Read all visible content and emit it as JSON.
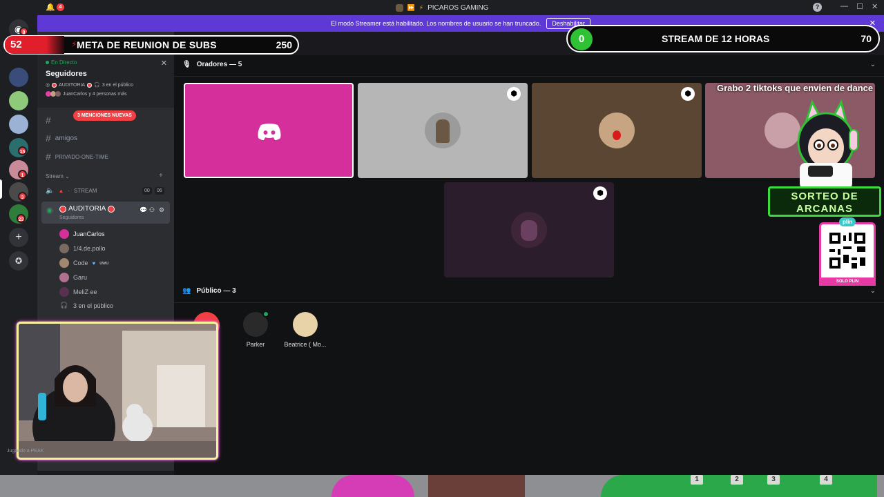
{
  "titlebar": {
    "server_name": "PICAROS GAMING",
    "notification_count": "4",
    "help": "?",
    "minimize": "—",
    "maximize": "☐",
    "close": "✕"
  },
  "banner": {
    "message": "El modo Streamer está habilitado. Los nombres de usuario se han truncado.",
    "disable_label": "Deshabilitar"
  },
  "rail": {
    "badges": [
      "8",
      "15",
      "1",
      "3",
      "23"
    ]
  },
  "sidebar": {
    "live_label": "En Directo",
    "stage_title": "Seguidores",
    "stage_host": "AUDITORIA",
    "stage_audience": "3 en el público",
    "stage_people": "JuanCarlos y 4 personas más",
    "mentions": "3 MENCIONES NUEVAS",
    "channels": [
      "amigos",
      "PRIVADO-ONE-TIME"
    ],
    "category": "Stream",
    "stream_channel": "STREAM",
    "timer_a": "00",
    "timer_b": "06",
    "active_voice": {
      "name": "AUDITORIA",
      "sub": "Seguidores"
    },
    "members": [
      {
        "name": "JuanCarlos"
      },
      {
        "name": "1/4.de.pollo"
      },
      {
        "name": "Code",
        "tag": "uwu"
      },
      {
        "name": "Garu"
      },
      {
        "name": "MeliZ ee"
      }
    ],
    "audience": "3 en el público",
    "user_status": "Jugando a PEAK"
  },
  "main": {
    "speakers_label": "Oradores — 5",
    "audience_label": "Público — 3",
    "audience": [
      {
        "name": "Parker"
      },
      {
        "name": "Beatrice ( Mo..."
      }
    ]
  },
  "overlay": {
    "left_bar": {
      "count": "52",
      "label": "META DE REUNION DE SUBS",
      "goal": "250"
    },
    "right_bar": {
      "count": "0",
      "label": "STREAM DE 12 HORAS",
      "goal": "70"
    },
    "tiktok_text": "Grabo 2 tiktoks que envien de dance",
    "sorteo_line1": "SORTEO DE",
    "sorteo_line2": "ARCANAS",
    "plin": "plin",
    "solo_plin": "SOLO PLIN",
    "keycaps": [
      "1",
      "2",
      "3",
      "4"
    ]
  },
  "colors": {
    "blurple": "#5e39d6",
    "discord_pink": "#d42f9b",
    "danger": "#f23f43",
    "online": "#23a55a"
  }
}
